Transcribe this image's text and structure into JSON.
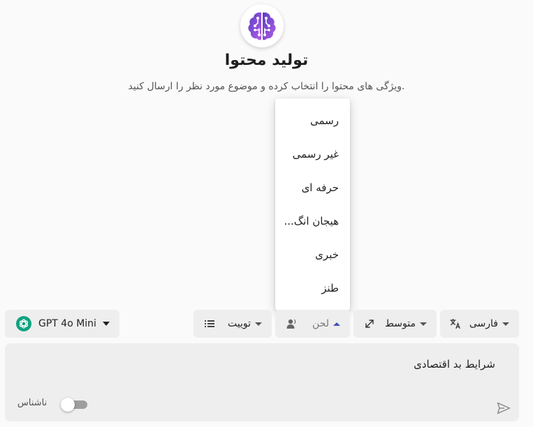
{
  "header": {
    "title": "تولید محتوا",
    "subtitle": "ویژگی های محتوا را انتخاب کرده و موضوع مورد نظر را ارسال کنید.",
    "logo_icon": "brain-icon"
  },
  "tone_menu": {
    "items": [
      "رسمی",
      "غیر رسمی",
      "حرفه ای",
      "هیجان انگ...",
      "خبری",
      "طنز"
    ]
  },
  "toolbar": {
    "model": {
      "label": "GPT 4o Mini",
      "icon": "openai-icon"
    },
    "format": {
      "label": "توییت",
      "icon": "list-icon"
    },
    "tone": {
      "label": "لحن",
      "icon": "person-icon"
    },
    "length": {
      "label": "متوسط",
      "icon": "expand-icon"
    },
    "language": {
      "label": "فارسی",
      "icon": "translate-icon"
    }
  },
  "input": {
    "value": "شرایط بد اقتصادی",
    "anonymous_label": "ناشناس",
    "anonymous_enabled": false,
    "send_icon": "send-icon"
  },
  "colors": {
    "accent": "#3f51b5",
    "logo_purple": "#8e44d6",
    "openai_green": "#10a37f"
  }
}
